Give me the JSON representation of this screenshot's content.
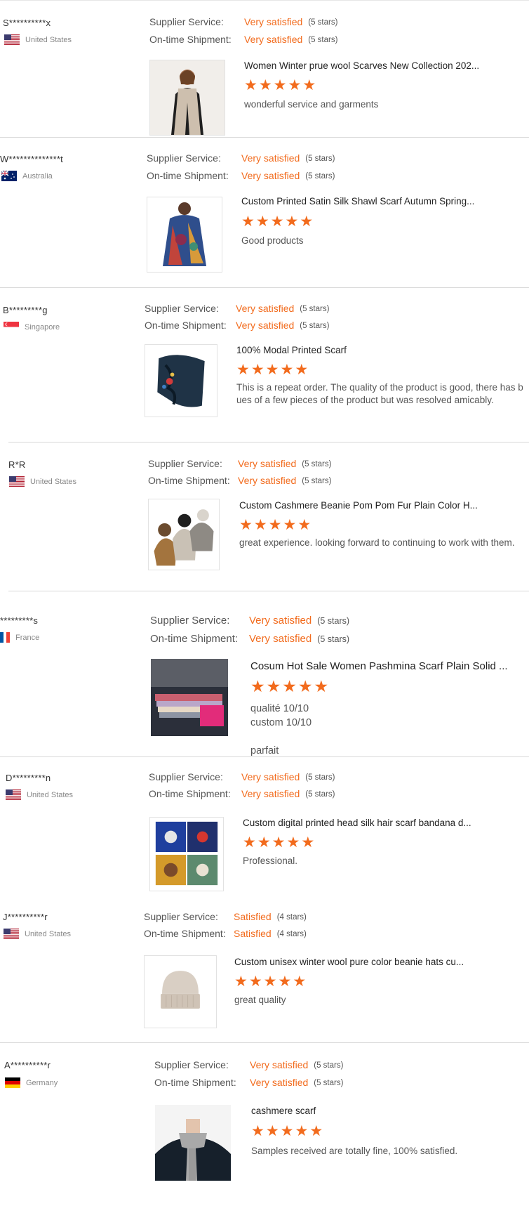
{
  "labels": {
    "supplier_service": "Supplier Service:",
    "ontime_shipment": "On-time Shipment:"
  },
  "colors": {
    "accent": "#f26b1d",
    "divider": "#d9d9d9"
  },
  "reviews": [
    {
      "user": "S**********x",
      "country": "United States",
      "flag": "us-flag-icon",
      "supplier_value": "Very satisfied",
      "supplier_stars": "(5 stars)",
      "shipment_value": "Very satisfied",
      "shipment_stars": "(5 stars)",
      "product_title": "Women Winter prue wool Scarves New Collection 202...",
      "rating": 5,
      "comment": "wonderful service and garments"
    },
    {
      "user": "W**************t",
      "country": "Australia",
      "flag": "au-flag-icon",
      "supplier_value": "Very satisfied",
      "supplier_stars": "(5 stars)",
      "shipment_value": "Very satisfied",
      "shipment_stars": "(5 stars)",
      "product_title": "Custom Printed Satin Silk Shawl Scarf Autumn Spring...",
      "rating": 5,
      "comment": "Good products"
    },
    {
      "user": "B*********g",
      "country": "Singapore",
      "flag": "sg-flag-icon",
      "supplier_value": "Very satisfied",
      "supplier_stars": "(5 stars)",
      "shipment_value": "Very satisfied",
      "shipment_stars": "(5 stars)",
      "product_title": "100% Modal Printed Scarf",
      "rating": 5,
      "comment": "This is a repeat order. The quality of the product is good, there has b\nues of a few pieces of the product but was resolved amicably."
    },
    {
      "user": "R*R",
      "country": "United States",
      "flag": "us-flag-icon",
      "supplier_value": "Very satisfied",
      "supplier_stars": "(5 stars)",
      "shipment_value": "Very satisfied",
      "shipment_stars": "(5 stars)",
      "product_title": "Custom Cashmere Beanie Pom Pom Fur Plain Color H...",
      "rating": 5,
      "comment": "great experience. looking forward to continuing to work with them."
    },
    {
      "user": "*********s",
      "country": "France",
      "flag": "fr-flag-icon",
      "supplier_value": "Very satisfied",
      "supplier_stars": "(5 stars)",
      "shipment_value": "Very satisfied",
      "shipment_stars": "(5 stars)",
      "product_title": "Cosum Hot Sale Women Pashmina Scarf Plain Solid ...",
      "rating": 5,
      "comment": "qualité 10/10\ncustom 10/10\n\nparfait"
    },
    {
      "user": "D*********n",
      "country": "United States",
      "flag": "us-flag-icon",
      "supplier_value": "Very satisfied",
      "supplier_stars": "(5 stars)",
      "shipment_value": "Very satisfied",
      "shipment_stars": "(5 stars)",
      "product_title": "Custom digital printed head silk hair scarf bandana d...",
      "rating": 5,
      "comment": "Professional."
    },
    {
      "user": "J**********r",
      "country": "United States",
      "flag": "us-flag-icon",
      "supplier_value": "Satisfied",
      "supplier_stars": "(4 stars)",
      "shipment_value": "Satisfied",
      "shipment_stars": "(4 stars)",
      "product_title": "Custom unisex winter wool pure color beanie hats cu...",
      "rating": 5,
      "comment": "great quality"
    },
    {
      "user": "A**********r",
      "country": "Germany",
      "flag": "de-flag-icon",
      "supplier_value": "Very satisfied",
      "supplier_stars": "(5 stars)",
      "shipment_value": "Very satisfied",
      "shipment_stars": "(5 stars)",
      "product_title": "cashmere scarf",
      "rating": 5,
      "comment": "Samples received are totally fine, 100% satisfied."
    }
  ]
}
